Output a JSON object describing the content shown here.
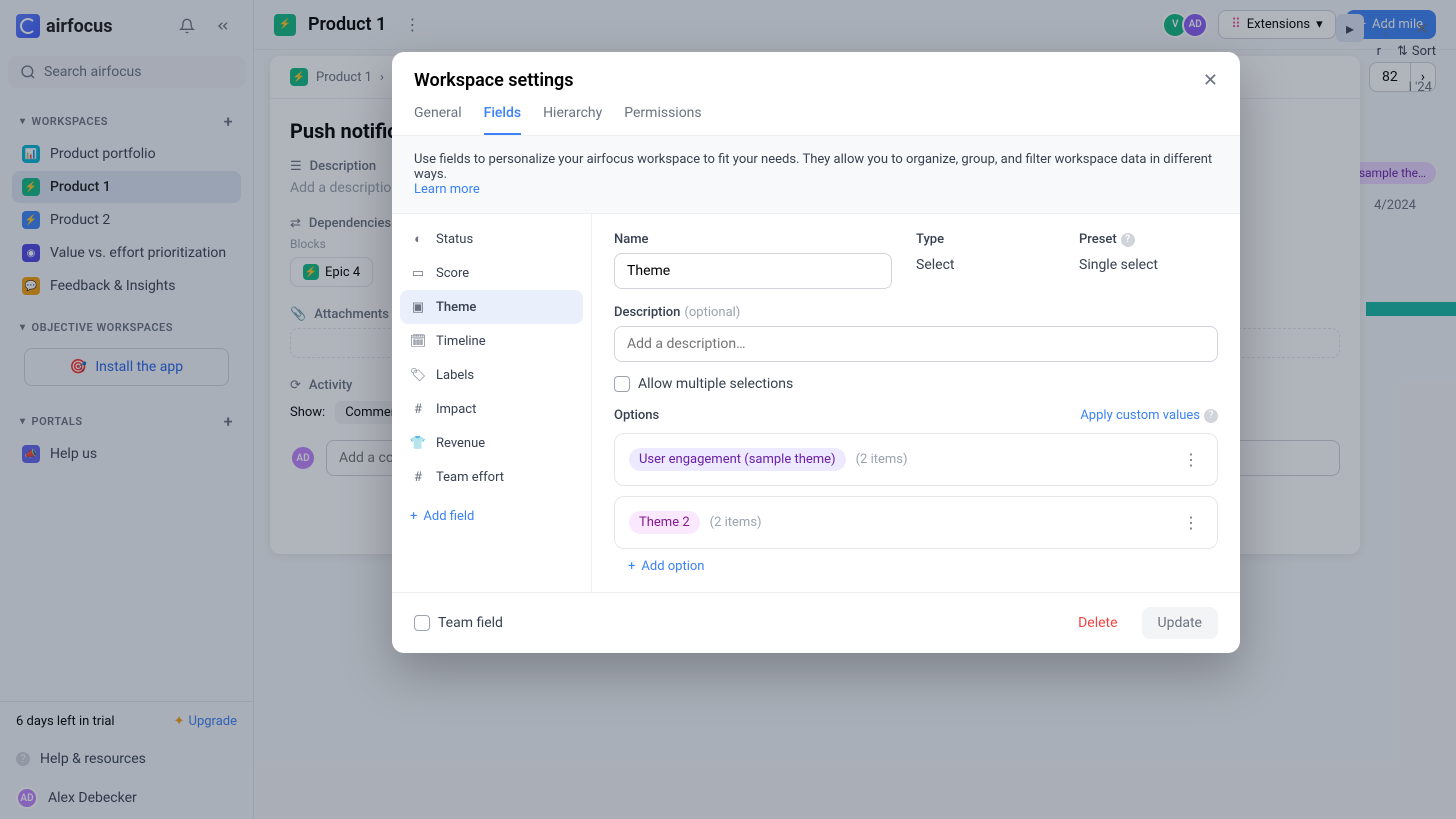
{
  "brand": "airfocus",
  "search": {
    "placeholder": "Search airfocus"
  },
  "sidebar": {
    "sections": {
      "workspaces": {
        "label": "WORKSPACES",
        "items": [
          {
            "label": "Product portfolio",
            "color": "#06b6d4"
          },
          {
            "label": "Product 1",
            "color": "#10b981"
          },
          {
            "label": "Product 2",
            "color": "#3b82f6"
          },
          {
            "label": "Value vs. effort prioritization",
            "color": "#4f46e5"
          },
          {
            "label": "Feedback & Insights",
            "color": "#f59e0b"
          }
        ]
      },
      "objective": {
        "label": "OBJECTIVE WORKSPACES",
        "install": "Install the app"
      },
      "portals": {
        "label": "PORTALS",
        "items": [
          {
            "label": "Help us",
            "color": "#6366f1"
          }
        ]
      }
    },
    "trial": {
      "text": "6 days left in trial",
      "upgrade": "Upgrade"
    },
    "footer": {
      "help": "Help & resources",
      "user": "Alex Debecker"
    }
  },
  "header": {
    "title": "Product 1",
    "avatars": [
      {
        "text": "V",
        "bg": "#10b981"
      },
      {
        "text": "AD",
        "bg": "#8b5cf6"
      }
    ],
    "extensions": "Extensions",
    "add": "Add mile"
  },
  "toolbar": {
    "filter": "r",
    "sort": "Sort",
    "page": "82",
    "month": "l '24"
  },
  "panel": {
    "crumb": "Product 1",
    "title": "Push notifica",
    "description": {
      "label": "Description",
      "placeholder": "Add a description."
    },
    "dependencies": {
      "label": "Dependencies",
      "blocks": "Blocks",
      "epic": "Epic 4"
    },
    "attachments": "Attachments",
    "activity": {
      "label": "Activity",
      "show": "Show:",
      "filter": "Commen"
    },
    "comment": {
      "placeholder": "Add a co",
      "user": "AD"
    }
  },
  "timeline": {
    "sample": "(sample the…",
    "date": "4/2024"
  },
  "modal": {
    "title": "Workspace settings",
    "tabs": [
      "General",
      "Fields",
      "Hierarchy",
      "Permissions"
    ],
    "hint": "Use fields to personalize your airfocus workspace to fit your needs. They allow you to organize, group, and filter workspace data in different ways.",
    "learn": "Learn more",
    "fields": [
      {
        "label": "Status",
        "icon": "○"
      },
      {
        "label": "Score",
        "icon": "▭"
      },
      {
        "label": "Theme",
        "icon": "▣"
      },
      {
        "label": "Timeline",
        "icon": "🗓"
      },
      {
        "label": "Labels",
        "icon": "🏷"
      },
      {
        "label": "Impact",
        "icon": "#"
      },
      {
        "label": "Revenue",
        "icon": "👕"
      },
      {
        "label": "Team effort",
        "icon": "#"
      }
    ],
    "addField": "Add field",
    "detail": {
      "nameLabel": "Name",
      "nameValue": "Theme",
      "typeLabel": "Type",
      "typeValue": "Select",
      "presetLabel": "Preset",
      "presetValue": "Single select",
      "descLabel": "Description",
      "descOptional": "(optional)",
      "descPlaceholder": "Add a description…",
      "multiLabel": "Allow multiple selections",
      "optionsLabel": "Options",
      "applyCustom": "Apply custom values",
      "options": [
        {
          "label": "User engagement (sample theme)",
          "count": "(2 items)",
          "chipClass": "chip-purple"
        },
        {
          "label": "Theme 2",
          "count": "(2 items)",
          "chipClass": "chip-pink"
        }
      ],
      "addOption": "Add option",
      "teamField": "Team field",
      "delete": "Delete",
      "update": "Update"
    }
  }
}
